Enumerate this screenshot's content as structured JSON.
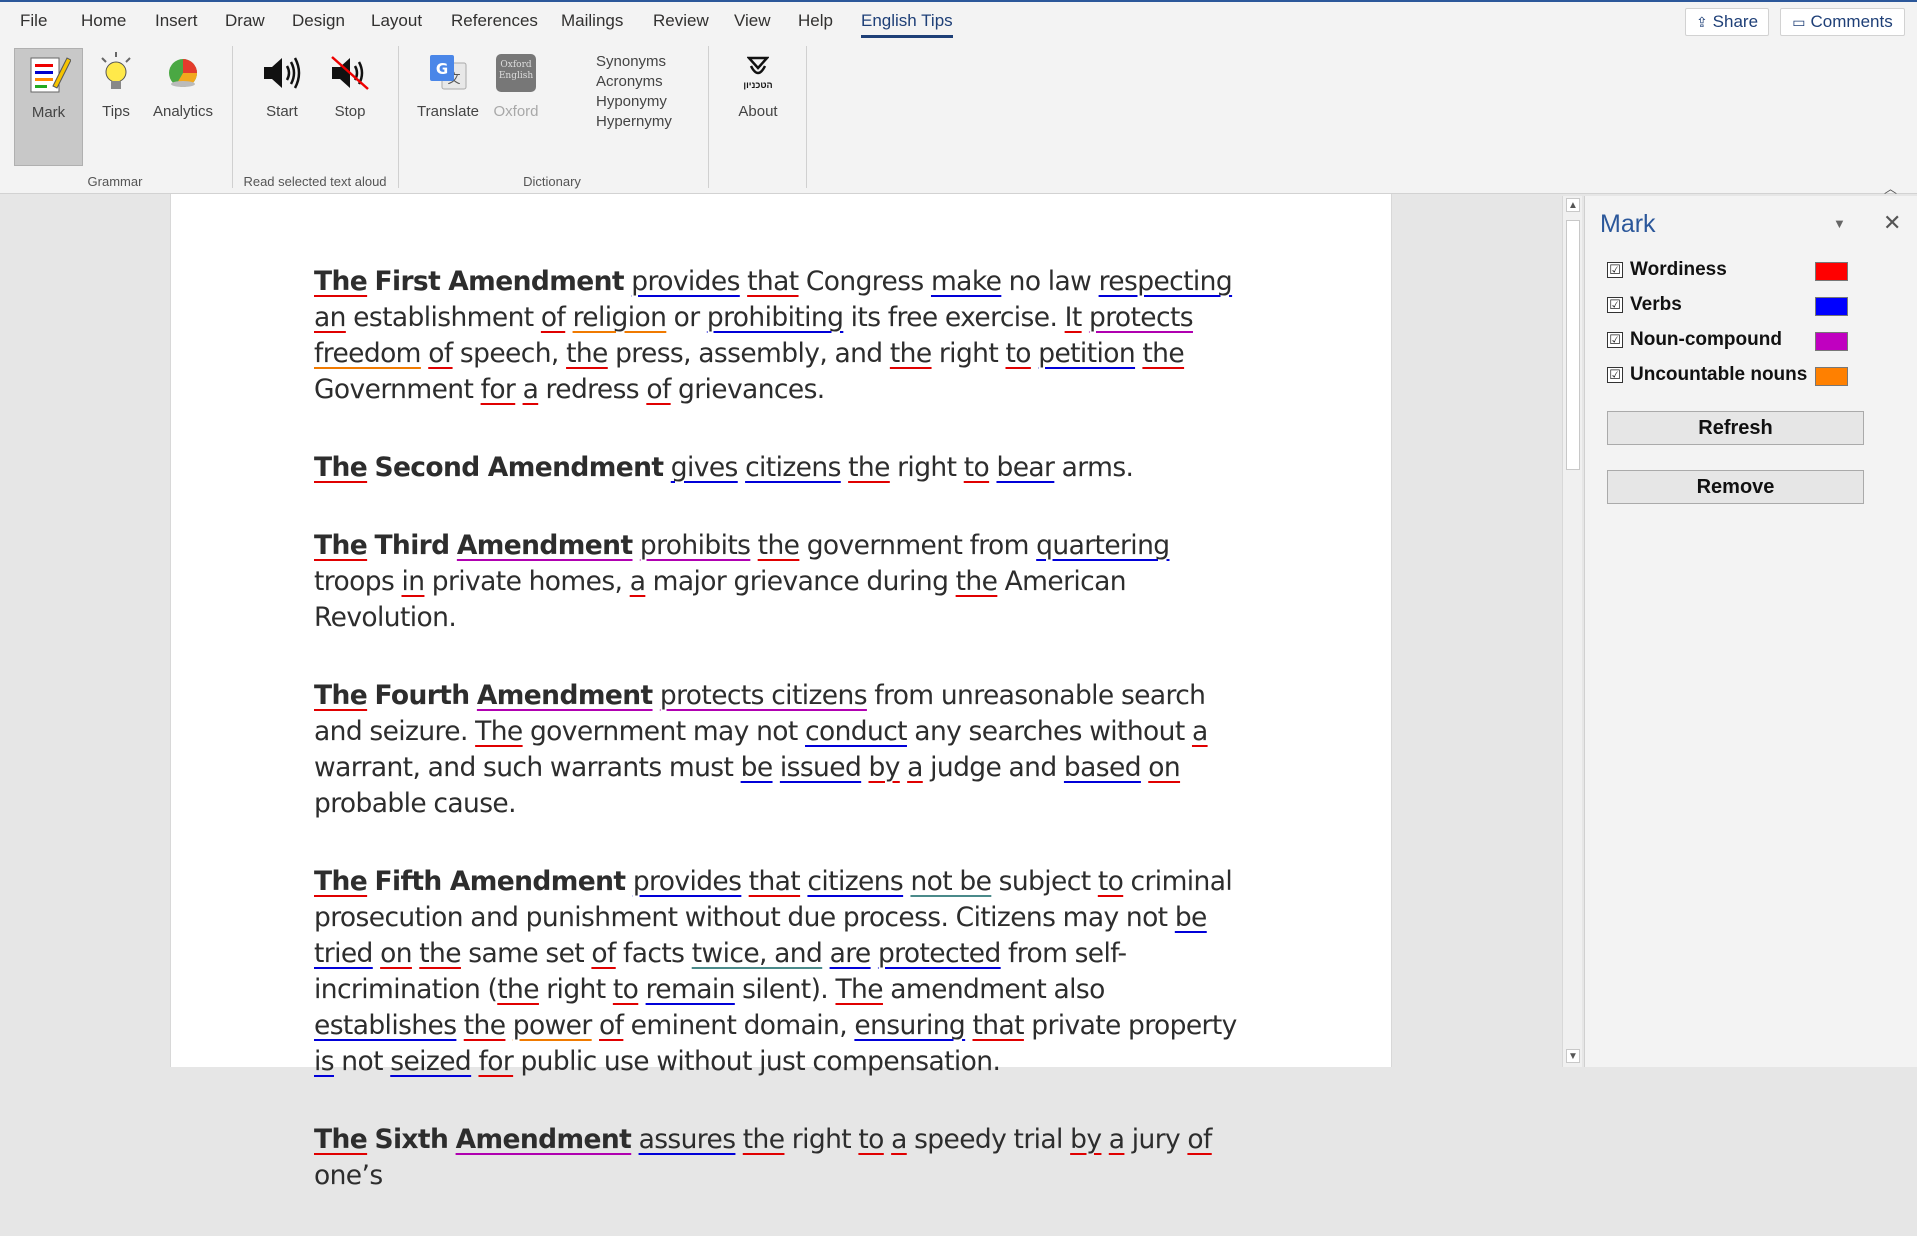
{
  "tabs": [
    "File",
    "Home",
    "Insert",
    "Draw",
    "Design",
    "Layout",
    "References",
    "Mailings",
    "Review",
    "View",
    "Help",
    "English Tips"
  ],
  "header": {
    "share": "Share",
    "comments": "Comments"
  },
  "ribbon": {
    "mark": "Mark",
    "tips": "Tips",
    "analytics": "Analytics",
    "start": "Start",
    "stop": "Stop",
    "translate": "Translate",
    "oxford": "Oxford",
    "dictionary_words": [
      "Synonyms",
      "Acronyms",
      "Hyponymy",
      "Hypernymy"
    ],
    "about": "About",
    "about_icon_text": "הטכניון",
    "oxford_icon_text": "Oxford English",
    "groups": {
      "grammar": "Grammar",
      "read": "Read selected text aloud",
      "dictionary": "Dictionary"
    }
  },
  "document": {
    "paragraphs": [
      {
        "segs": [
          [
            "The",
            "w r b"
          ],
          [
            " ",
            ""
          ],
          [
            "First Amendment",
            "b"
          ],
          [
            " ",
            ""
          ],
          [
            "provides",
            "w bl"
          ],
          [
            " ",
            ""
          ],
          [
            "that",
            "w r"
          ],
          [
            " Congress ",
            ""
          ],
          [
            "make",
            "w bl"
          ],
          [
            " no law ",
            ""
          ],
          [
            "respecting",
            "w bl"
          ],
          [
            " ",
            ""
          ],
          [
            "an",
            "w r"
          ],
          [
            " establishment ",
            ""
          ],
          [
            "of",
            "w r"
          ],
          [
            " ",
            ""
          ],
          [
            "religion",
            "w or"
          ],
          [
            " or ",
            ""
          ],
          [
            "prohibiting",
            "w bl"
          ],
          [
            " its free exercise. ",
            ""
          ],
          [
            "It",
            "w r"
          ],
          [
            " ",
            ""
          ],
          [
            "protects",
            "w pu"
          ],
          [
            " ",
            ""
          ],
          [
            "freedom",
            "w or"
          ],
          [
            " ",
            ""
          ],
          [
            "of",
            "w r"
          ],
          [
            " speech, ",
            ""
          ],
          [
            "the",
            "w r"
          ],
          [
            " press, assembly, and ",
            ""
          ],
          [
            "the",
            "w r"
          ],
          [
            " right ",
            ""
          ],
          [
            "to",
            "w r"
          ],
          [
            " ",
            ""
          ],
          [
            "petition",
            "w bl"
          ],
          [
            " ",
            ""
          ],
          [
            "the",
            "w r"
          ],
          [
            " Government ",
            ""
          ],
          [
            "for",
            "w r"
          ],
          [
            " ",
            ""
          ],
          [
            "a",
            "w r"
          ],
          [
            " redress ",
            ""
          ],
          [
            "of",
            "w r"
          ],
          [
            " grievances.",
            ""
          ]
        ]
      },
      {
        "segs": [
          [
            "The",
            "w r b"
          ],
          [
            " ",
            ""
          ],
          [
            "Second Amendment",
            "b"
          ],
          [
            " ",
            ""
          ],
          [
            "gives",
            "w bl"
          ],
          [
            " ",
            ""
          ],
          [
            "citizens",
            "w bl"
          ],
          [
            " ",
            ""
          ],
          [
            "the",
            "w r"
          ],
          [
            " right ",
            ""
          ],
          [
            "to",
            "w r"
          ],
          [
            " ",
            ""
          ],
          [
            "bear",
            "w bl"
          ],
          [
            " arms.",
            ""
          ]
        ]
      },
      {
        "segs": [
          [
            "The",
            "w r b"
          ],
          [
            " ",
            ""
          ],
          [
            "Third",
            "b"
          ],
          [
            " ",
            ""
          ],
          [
            "Amendment",
            "w pu b"
          ],
          [
            " ",
            ""
          ],
          [
            "prohibits",
            "w pu"
          ],
          [
            " ",
            ""
          ],
          [
            "the",
            "w r"
          ],
          [
            " government from ",
            ""
          ],
          [
            "quartering",
            "w bl"
          ],
          [
            " troops ",
            ""
          ],
          [
            "in",
            "w r"
          ],
          [
            " private homes, ",
            ""
          ],
          [
            "a",
            "w r"
          ],
          [
            " major grievance during ",
            ""
          ],
          [
            "the",
            "w r"
          ],
          [
            " American Revolution.",
            ""
          ]
        ]
      },
      {
        "segs": [
          [
            "The",
            "w r b"
          ],
          [
            " ",
            ""
          ],
          [
            "Fourth",
            "b"
          ],
          [
            " ",
            ""
          ],
          [
            "Amendment",
            "w pu b"
          ],
          [
            " ",
            ""
          ],
          [
            "protects citizens",
            "w pu"
          ],
          [
            " from unreasonable search and seizure. ",
            ""
          ],
          [
            "The",
            "w r"
          ],
          [
            " government may not ",
            ""
          ],
          [
            "conduct",
            "w bl"
          ],
          [
            " any searches without ",
            ""
          ],
          [
            "a",
            "w r"
          ],
          [
            " warrant, and such warrants must ",
            ""
          ],
          [
            "be",
            "w bl"
          ],
          [
            " ",
            ""
          ],
          [
            "issued",
            "w bl"
          ],
          [
            " ",
            ""
          ],
          [
            "by",
            "w r"
          ],
          [
            " ",
            ""
          ],
          [
            "a",
            "w r"
          ],
          [
            " judge and ",
            ""
          ],
          [
            "based",
            "w bl"
          ],
          [
            " ",
            ""
          ],
          [
            "on",
            "w r"
          ],
          [
            " probable cause.",
            ""
          ]
        ]
      },
      {
        "segs": [
          [
            "The",
            "w r b"
          ],
          [
            " ",
            ""
          ],
          [
            "Fifth Amendment",
            "b"
          ],
          [
            " ",
            ""
          ],
          [
            "provides",
            "w bl"
          ],
          [
            " ",
            ""
          ],
          [
            "that",
            "w r"
          ],
          [
            " ",
            ""
          ],
          [
            "citizens",
            "w bl"
          ],
          [
            " ",
            ""
          ],
          [
            "not be",
            "w gr"
          ],
          [
            " subject ",
            ""
          ],
          [
            "to",
            "w r"
          ],
          [
            " criminal prosecution and punishment without due process. Citizens may not ",
            ""
          ],
          [
            "be",
            "w bl"
          ],
          [
            " ",
            ""
          ],
          [
            "tried",
            "w bl"
          ],
          [
            " ",
            ""
          ],
          [
            "on",
            "w r"
          ],
          [
            " ",
            ""
          ],
          [
            "the",
            "w r"
          ],
          [
            " same set ",
            ""
          ],
          [
            "of",
            "w r"
          ],
          [
            " facts ",
            ""
          ],
          [
            "twice, and",
            "w gr"
          ],
          [
            " ",
            ""
          ],
          [
            "are",
            "w bl"
          ],
          [
            " ",
            ""
          ],
          [
            "protected",
            "w bl"
          ],
          [
            " from self-incrimination (",
            ""
          ],
          [
            "the",
            "w r"
          ],
          [
            " right ",
            ""
          ],
          [
            "to",
            "w r"
          ],
          [
            " ",
            ""
          ],
          [
            "remain",
            "w bl"
          ],
          [
            " silent). ",
            ""
          ],
          [
            "The",
            "w r"
          ],
          [
            " amendment also ",
            ""
          ],
          [
            "establishes",
            "w bl"
          ],
          [
            " ",
            ""
          ],
          [
            "the",
            "w r"
          ],
          [
            " ",
            ""
          ],
          [
            "power",
            "w or"
          ],
          [
            " ",
            ""
          ],
          [
            "of",
            "w r"
          ],
          [
            " eminent domain, ",
            ""
          ],
          [
            "ensuring",
            "w bl"
          ],
          [
            " ",
            ""
          ],
          [
            "that",
            "w r"
          ],
          [
            " private property ",
            ""
          ],
          [
            "is",
            "w bl"
          ],
          [
            " not ",
            ""
          ],
          [
            "seized",
            "w bl"
          ],
          [
            " ",
            ""
          ],
          [
            "for",
            "w r"
          ],
          [
            " public use without just compensation.",
            ""
          ]
        ]
      },
      {
        "segs": [
          [
            "The",
            "w r b"
          ],
          [
            " ",
            ""
          ],
          [
            "Sixth",
            "b"
          ],
          [
            " ",
            ""
          ],
          [
            "Amendment",
            "w pu b"
          ],
          [
            " ",
            ""
          ],
          [
            "assures",
            "w bl"
          ],
          [
            " ",
            ""
          ],
          [
            "the",
            "w r"
          ],
          [
            " right ",
            ""
          ],
          [
            "to",
            "w r"
          ],
          [
            " ",
            ""
          ],
          [
            "a",
            "w r"
          ],
          [
            " speedy trial ",
            ""
          ],
          [
            "by",
            "w r"
          ],
          [
            " ",
            ""
          ],
          [
            "a",
            "w r"
          ],
          [
            " jury ",
            ""
          ],
          [
            "of",
            "w r"
          ],
          [
            " one’s",
            ""
          ]
        ]
      }
    ]
  },
  "pane": {
    "title": "Mark",
    "categories": [
      {
        "label": "Wordiness",
        "color": "#ff0000",
        "checked": "☑"
      },
      {
        "label": "Verbs",
        "color": "#0000ff",
        "checked": "☑"
      },
      {
        "label": "Noun-compound",
        "color": "#c000c0",
        "checked": "☑"
      },
      {
        "label": "Uncountable nouns",
        "color": "#ff8000",
        "checked": "☑"
      }
    ],
    "refresh": "Refresh",
    "remove": "Remove"
  }
}
